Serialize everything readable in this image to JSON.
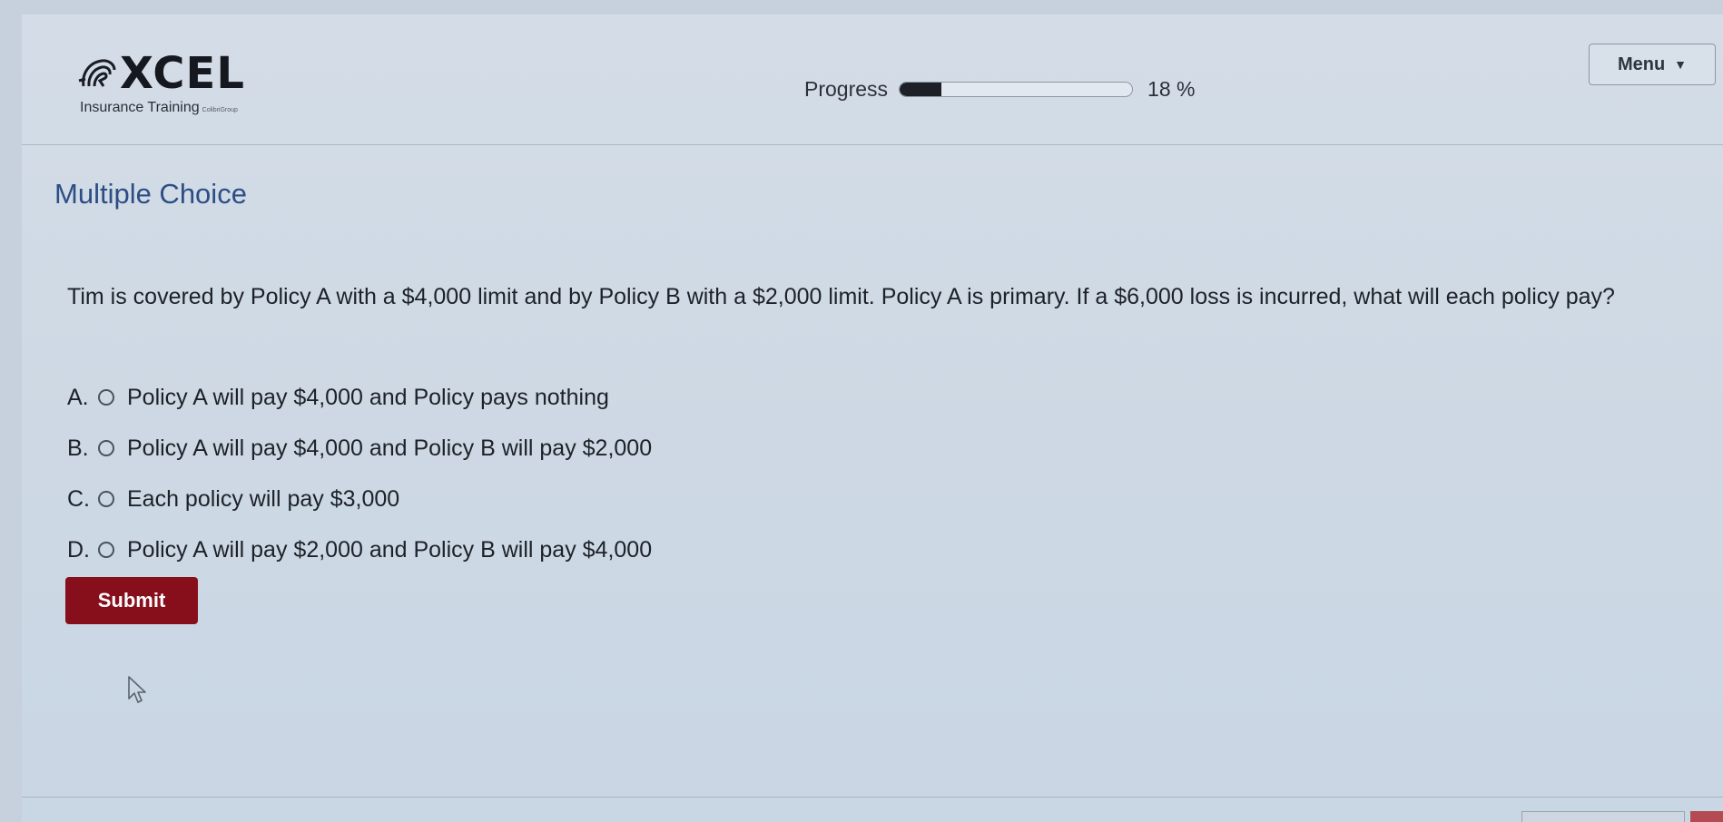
{
  "brand": {
    "name": "XCEL",
    "tagline": "Insurance Training",
    "tagline_small": "ColibriGroup"
  },
  "progress": {
    "label": "Progress",
    "percent": 18,
    "value_text": "18 %"
  },
  "menu": {
    "label": "Menu",
    "caret": "▼"
  },
  "section_title": "Multiple Choice",
  "question": "Tim is covered by Policy A with a $4,000 limit and by Policy B with a $2,000 limit. Policy A is primary. If a $6,000 loss is incurred, what will each policy pay?",
  "options": [
    {
      "letter": "A.",
      "text": "Policy A will pay $4,000 and Policy pays nothing"
    },
    {
      "letter": "B.",
      "text": "Policy A will pay $4,000 and Policy B will pay $2,000"
    },
    {
      "letter": "C.",
      "text": "Each policy will pay $3,000"
    },
    {
      "letter": "D.",
      "text": "Policy A will pay $2,000 and Policy B will pay $4,000"
    }
  ],
  "submit_label": "Submit",
  "colors": {
    "submit": "#870f1c",
    "section_title": "#2d4e84",
    "progress_fill": "#1d2127"
  }
}
